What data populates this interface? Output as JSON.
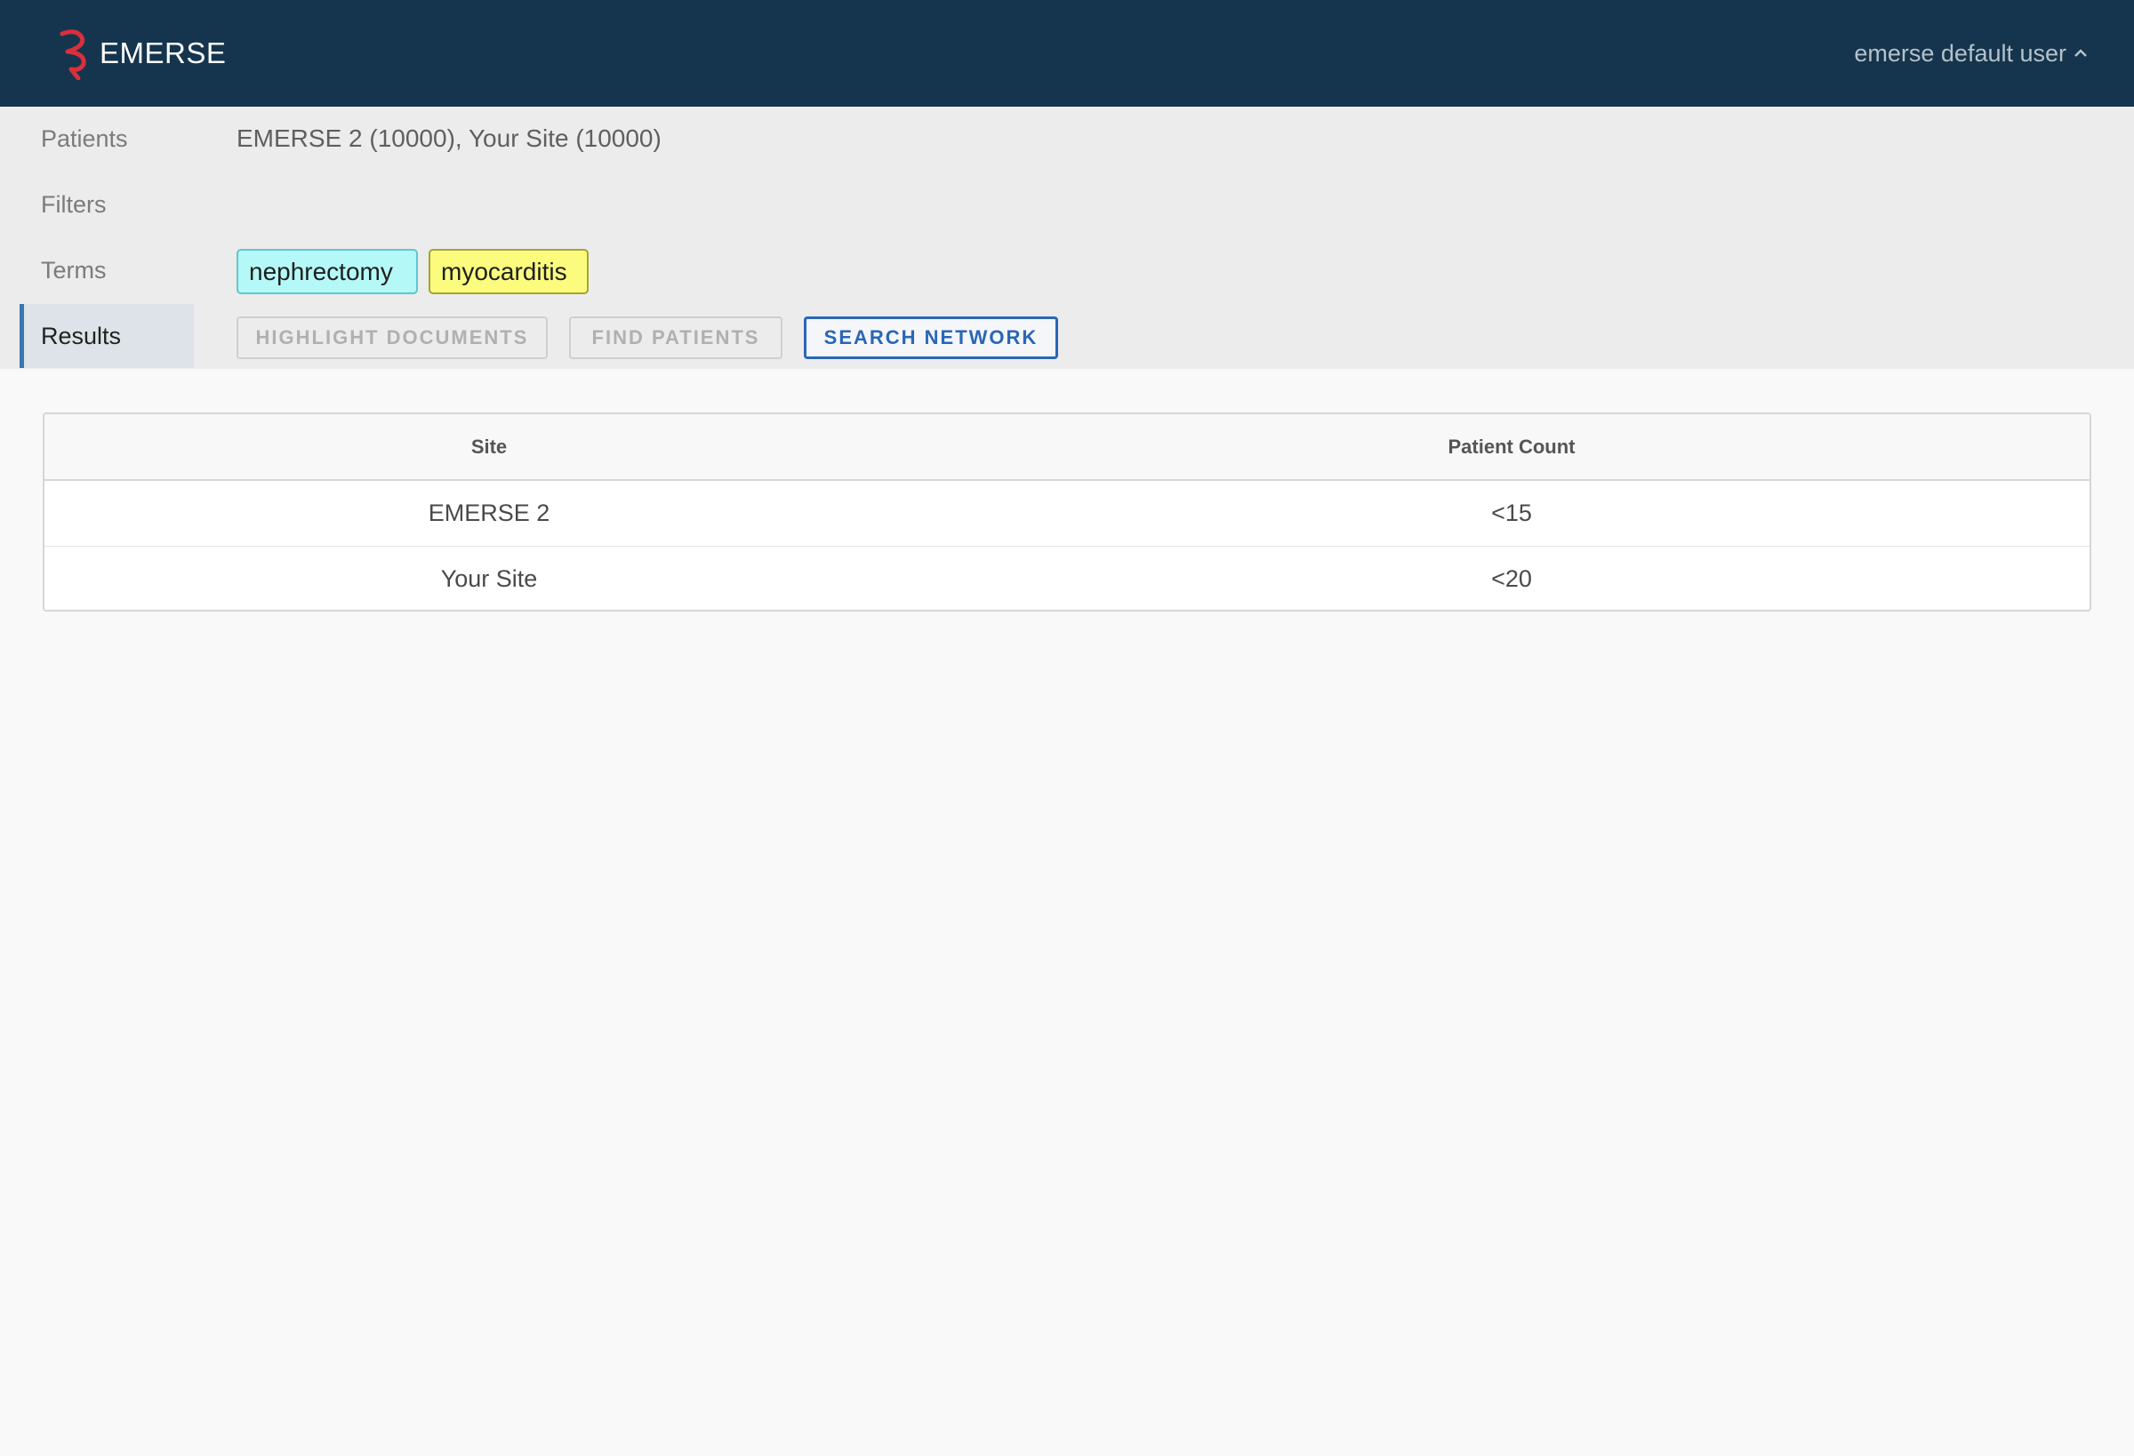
{
  "header": {
    "brand": "EMERSE",
    "user": "emerse default user"
  },
  "sidebar": {
    "items": [
      {
        "label": "Patients"
      },
      {
        "label": "Filters"
      },
      {
        "label": "Terms"
      },
      {
        "label": "Results",
        "active": true
      }
    ]
  },
  "patients": {
    "sites_summary": "EMERSE 2 (10000), Your Site (10000)"
  },
  "terms": [
    {
      "label": "nephrectomy",
      "bg": "#b5f8f8",
      "border": "#5fc7cf"
    },
    {
      "label": "myocarditis",
      "bg": "#fbfc7d",
      "border": "#a7a233"
    }
  ],
  "actions": {
    "highlight": "HIGHLIGHT DOCUMENTS",
    "find": "FIND PATIENTS",
    "search": "SEARCH NETWORK"
  },
  "results": {
    "columns": [
      "Site",
      "Patient Count"
    ],
    "rows": [
      {
        "site": "EMERSE 2",
        "count": "<15"
      },
      {
        "site": "Your Site",
        "count": "<20"
      }
    ]
  },
  "colors": {
    "header_bg": "#14354d",
    "accent": "#2a66b6",
    "logo_red": "#d8303c"
  }
}
